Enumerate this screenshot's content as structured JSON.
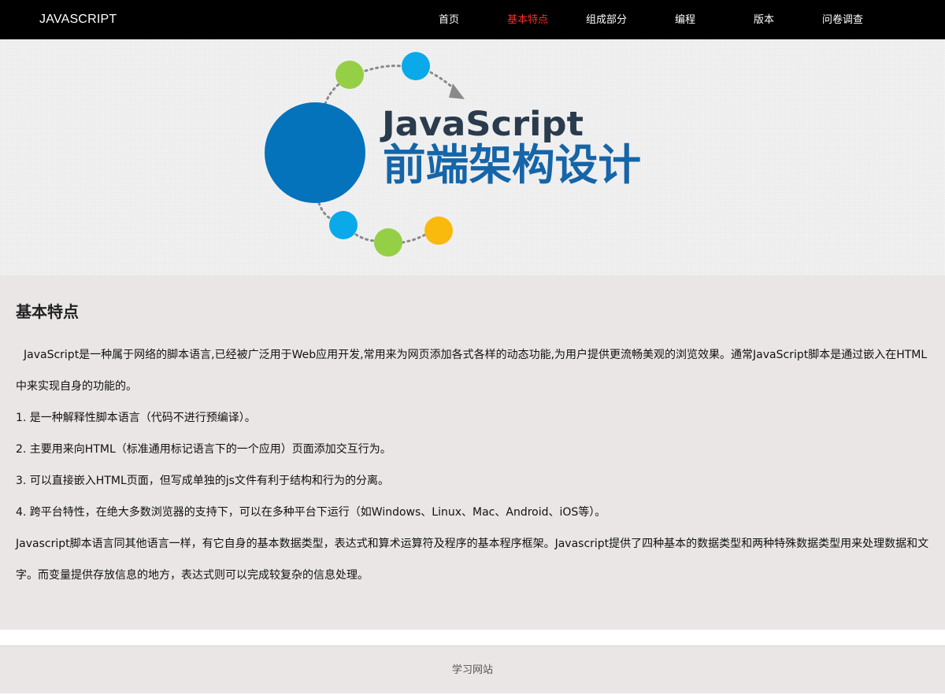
{
  "header": {
    "brand": "JAVASCRIPT",
    "nav": [
      {
        "label": "首页",
        "active": false
      },
      {
        "label": "基本特点",
        "active": true
      },
      {
        "label": "组成部分",
        "active": false
      },
      {
        "label": "编程",
        "active": false
      },
      {
        "label": "版本",
        "active": false
      },
      {
        "label": "问卷调查",
        "active": false
      }
    ],
    "active_color": "#ff2a2a"
  },
  "banner": {
    "logo_line1": "JavaScript",
    "logo_line2": "前端架构设计",
    "colors": {
      "dark_blue": "#0572bc",
      "light_blue": "#0aa9e9",
      "green": "#95cf45",
      "yellow": "#f9b90d",
      "title_text": "#2a3b4d",
      "subtitle_text": "#1565a8"
    }
  },
  "main": {
    "title": "基本特点",
    "intro": "JavaScript是一种属于网络的脚本语言,已经被广泛用于Web应用开发,常用来为网页添加各式各样的动态功能,为用户提供更流畅美观的浏览效果。通常JavaScript脚本是通过嵌入在HTML中来实现自身的功能的。",
    "points": [
      "1. 是一种解释性脚本语言（代码不进行预编译）。",
      "2. 主要用来向HTML（标准通用标记语言下的一个应用）页面添加交互行为。",
      "3. 可以直接嵌入HTML页面，但写成单独的js文件有利于结构和行为的分离。",
      "4. 跨平台特性，在绝大多数浏览器的支持下，可以在多种平台下运行（如Windows、Linux、Mac、Android、iOS等）。"
    ],
    "closing": "Javascript脚本语言同其他语言一样，有它自身的基本数据类型，表达式和算术运算符及程序的基本程序框架。Javascript提供了四种基本的数据类型和两种特殊数据类型用来处理数据和文字。而变量提供存放信息的地方，表达式则可以完成较复杂的信息处理。"
  },
  "footer": {
    "text": "学习网站"
  }
}
